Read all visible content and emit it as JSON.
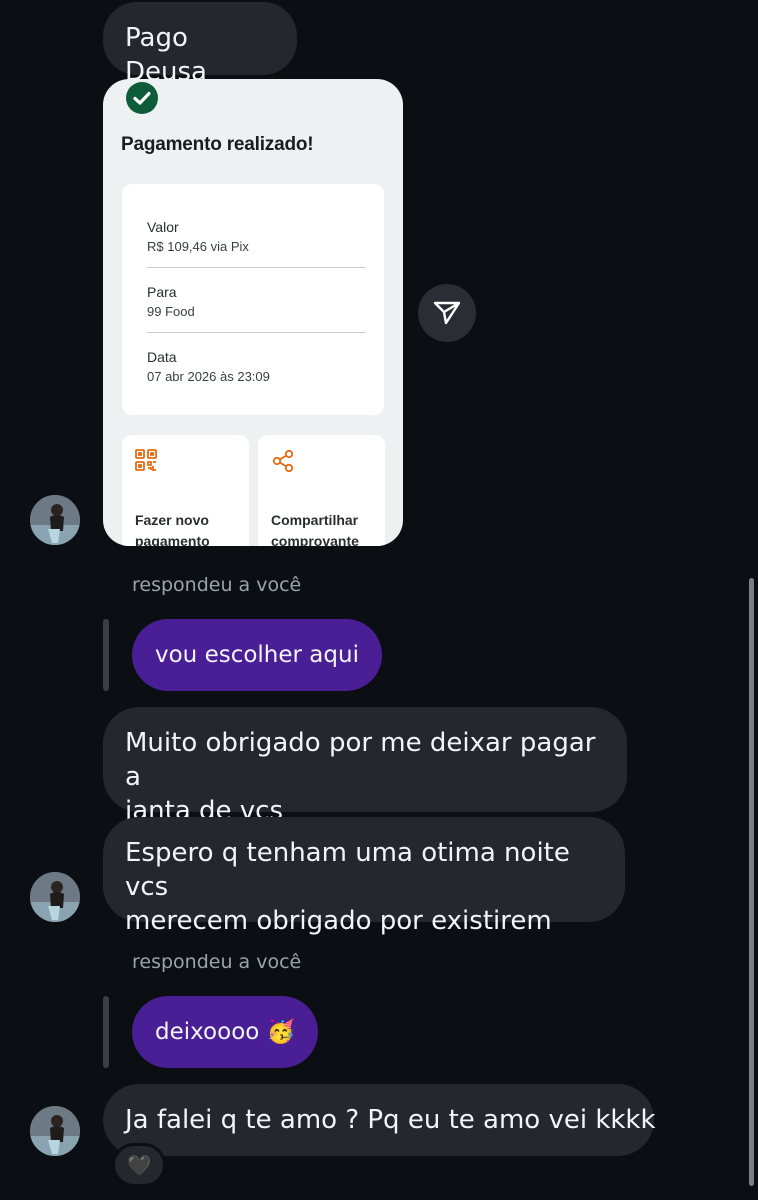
{
  "messages": {
    "m1": "Pago Deusa",
    "m2_line1": "Muito obrigado por me deixar pagar a",
    "m2_line2": "janta de vcs",
    "m3_line1": "Espero q tenham uma otima noite vcs",
    "m3_line2": "merecem obrigado por existirem",
    "m4": "Ja falei q te amo ? Pq eu te amo vei kkkk"
  },
  "replies": {
    "r1_label": "respondeu a você",
    "r1_text": "vou escolher aqui",
    "r2_label": "respondeu a você",
    "r2_text": "deixoooo",
    "r2_emoji": "🥳"
  },
  "receipt": {
    "title": "Pagamento realizado!",
    "rows": [
      {
        "label": "Valor",
        "value": "R$ 109,46 via Pix"
      },
      {
        "label": "Para",
        "value": "99 Food"
      },
      {
        "label": "Data",
        "value": "07 abr 2026 às 23:09"
      }
    ],
    "actions": [
      {
        "label": "Fazer novo pagamento",
        "icon": "qr-code-icon"
      },
      {
        "label": "Compartilhar comprovante",
        "icon": "share-icon"
      }
    ],
    "accent": "#e8690f",
    "check_color": "#0f5c3a"
  },
  "reaction": {
    "emoji": "🖤"
  },
  "colors": {
    "background": "#0b0f14",
    "bubble": "#24282e",
    "reply_bubble": "#4a1f96"
  }
}
